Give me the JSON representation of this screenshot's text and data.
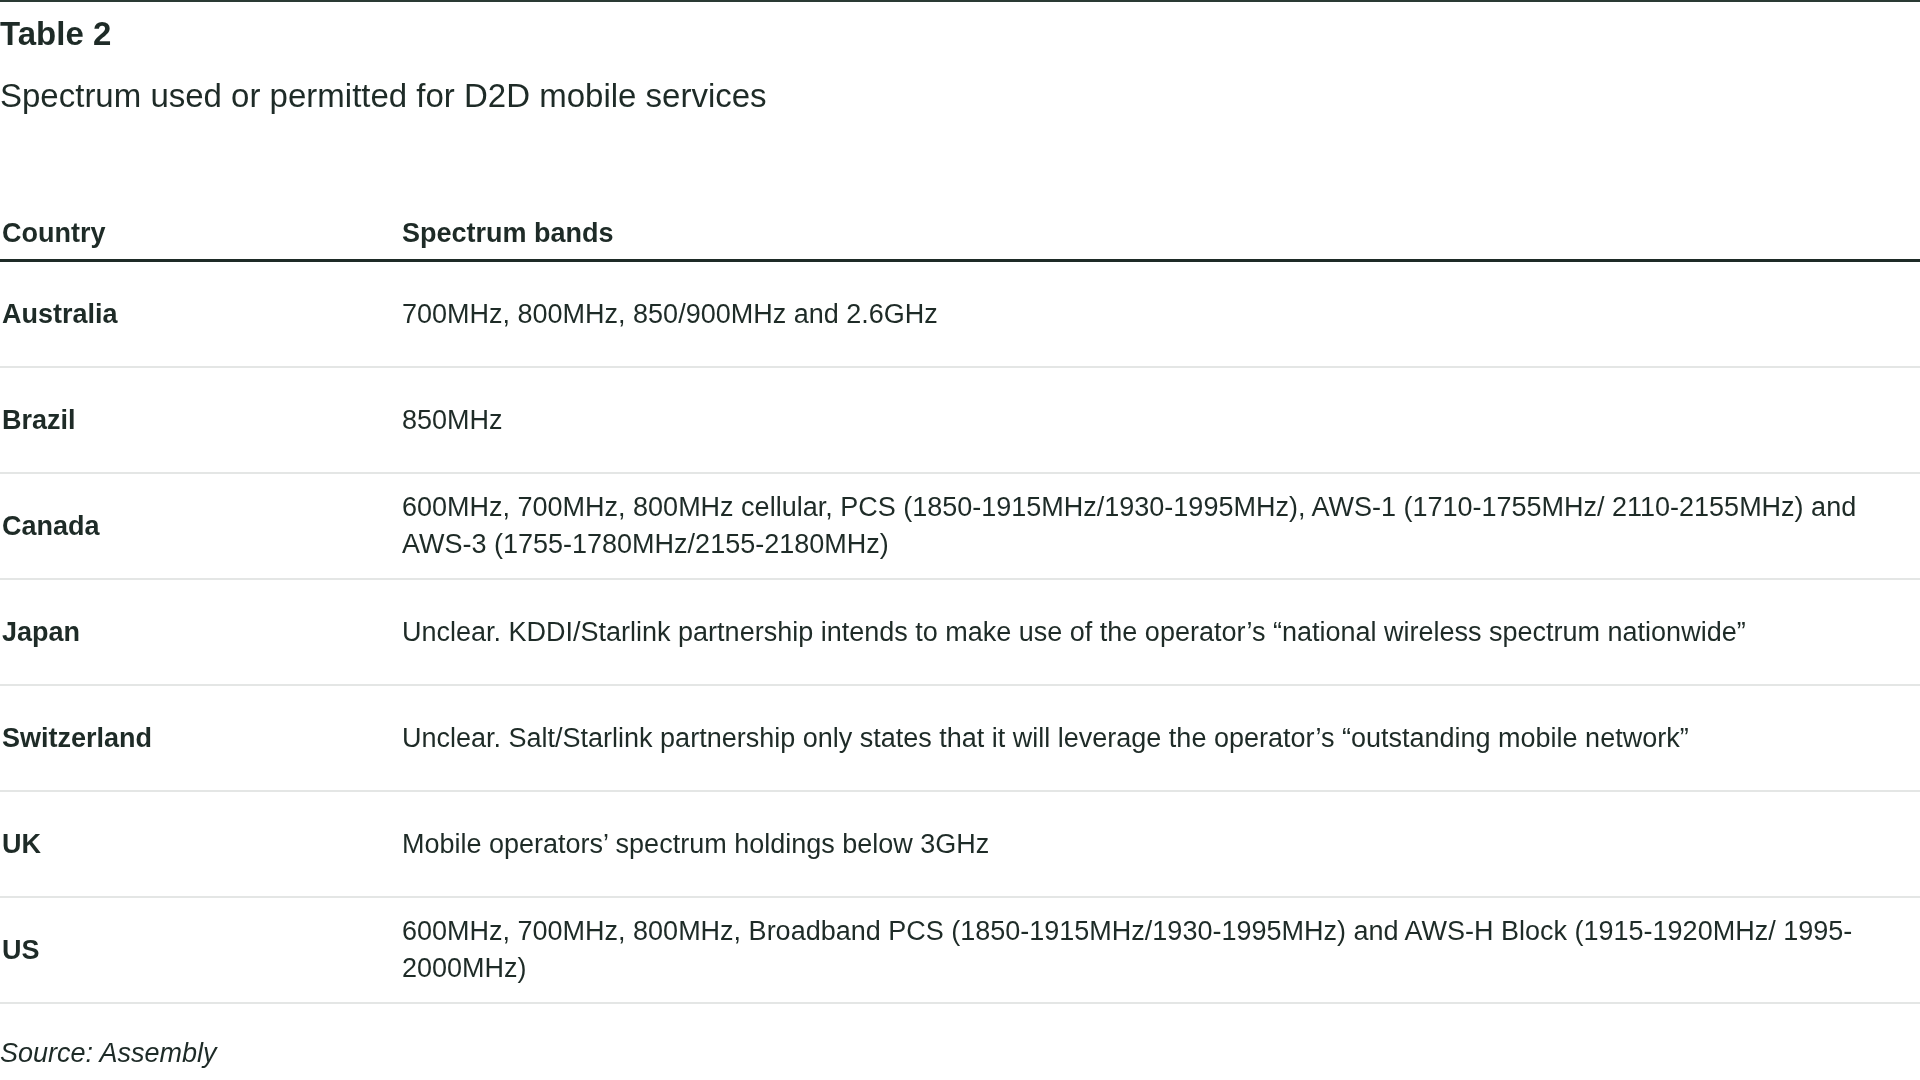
{
  "title": "Table 2",
  "subtitle": "Spectrum used or permitted for D2D mobile services",
  "table": {
    "columns": [
      "Country",
      "Spectrum bands"
    ],
    "rows": [
      {
        "country": "Australia",
        "bands": "700MHz, 800MHz, 850/900MHz and 2.6GHz"
      },
      {
        "country": "Brazil",
        "bands": "850MHz"
      },
      {
        "country": "Canada",
        "bands": "600MHz, 700MHz, 800MHz cellular, PCS (1850-1915MHz/1930-1995MHz), AWS-1 (1710-1755MHz/ 2110-2155MHz) and AWS-3 (1755-1780MHz/2155-2180MHz)"
      },
      {
        "country": "Japan",
        "bands": "Unclear. KDDI/Starlink partnership intends to make use of the operator’s “national wireless spectrum nationwide”"
      },
      {
        "country": "Switzerland",
        "bands": "Unclear. Salt/Starlink partnership only states that it will leverage the operator’s “outstanding mobile network”"
      },
      {
        "country": "UK",
        "bands": "Mobile operators’ spectrum holdings below 3GHz"
      },
      {
        "country": "US",
        "bands": "600MHz, 700MHz, 800MHz, Broadband PCS (1850-1915MHz/1930-1995MHz) and AWS-H Block (1915-1920MHz/ 1995-2000MHz)"
      }
    ]
  },
  "source": "Source: Assembly"
}
